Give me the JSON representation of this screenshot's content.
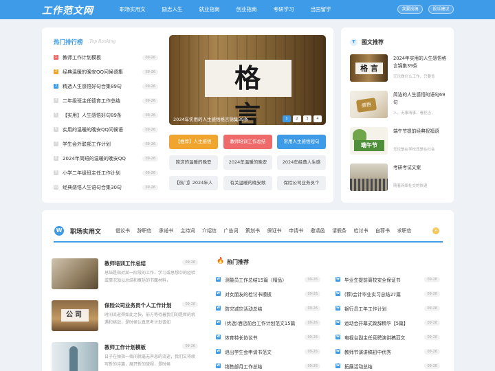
{
  "header": {
    "logo": "工作范文网",
    "nav": [
      "职场实用文",
      "励志人生",
      "就业指南",
      "创业指南",
      "考研学习",
      "出国留学"
    ],
    "login": "我要投稿",
    "register": "投诉建议"
  },
  "ranking": {
    "title": "热门排行榜",
    "subtitle": "Top Ranking",
    "items": [
      {
        "num": "1",
        "text": "教师工作计划模板",
        "date": "09-26"
      },
      {
        "num": "2",
        "text": "经典温暖的晚安QQ问候语集",
        "date": "09-26"
      },
      {
        "num": "3",
        "text": "精选人生感悟好句合集89句",
        "date": "09-26"
      },
      {
        "num": "4",
        "text": "二年级班主任德育工作总结",
        "date": "09-26"
      },
      {
        "num": "5",
        "text": "【实用】人生感悟好句89条",
        "date": "09-26"
      },
      {
        "num": "6",
        "text": "实用的温暖的晚安QQ问候语",
        "date": "09-26"
      },
      {
        "num": "7",
        "text": "学生会外联部工作计划",
        "date": "09-26"
      },
      {
        "num": "8",
        "text": "2024年简短的温暖的晚安QQ",
        "date": "09-26"
      },
      {
        "num": "9",
        "text": "小学二年级班主任工作计划",
        "date": "09-26"
      },
      {
        "num": "10",
        "text": "经典感悟人生语句合集30句",
        "date": "09-26"
      }
    ]
  },
  "banner": {
    "big_text": "格言",
    "caption": "2024年实用的人生感悟格言锦集39条",
    "pages": [
      "1",
      "2",
      "3",
      "4"
    ]
  },
  "tags": [
    {
      "text": "【推荐】人生感悟",
      "bg": "#f0a62e",
      "color": "#fff"
    },
    {
      "text": "教师培训工作总结",
      "bg": "#ef6b6b",
      "color": "#fff"
    },
    {
      "text": "常用人生感悟短句",
      "bg": "#3e9be8",
      "color": "#fff"
    },
    {
      "text": "简洁的温暖的晚安",
      "bg": "#eef0f3",
      "color": "#444"
    },
    {
      "text": "2024年温暖的晚安",
      "bg": "#eef0f3",
      "color": "#444"
    },
    {
      "text": "2024年经典人生感",
      "bg": "#eef0f3",
      "color": "#444"
    },
    {
      "text": "【热门】2024年人",
      "bg": "#eef0f3",
      "color": "#444"
    },
    {
      "text": "有关温暖的晚安歌",
      "bg": "#eef0f3",
      "color": "#444"
    },
    {
      "text": "保险公司业务员个",
      "bg": "#eef0f3",
      "color": "#444"
    }
  ],
  "picks": {
    "icon": "T",
    "title": "图文推荐",
    "items": [
      {
        "name": "2024年实用的人生感悟格言锦集39条",
        "desc": "无论做什么工作，只要肯",
        "img_text": "格 言"
      },
      {
        "name": "简洁的人生感悟的语句69句",
        "desc": "人，无事清事，看犯当，",
        "img_text": "感悟"
      },
      {
        "name": "端午节提前经典祝福语",
        "desc": "无论是在学校还是在社会",
        "img_text": "端午节"
      },
      {
        "name": "考研考试文案",
        "desc": "随着网络社交的快速",
        "img_text": ""
      }
    ]
  },
  "section": {
    "icon": "W",
    "title": "职场实用文",
    "cats": [
      "倡议书",
      "辞职信",
      "承诺书",
      "主持词",
      "介绍信",
      "广告词",
      "策划书",
      "保证书",
      "申请书",
      "邀请函",
      "请假条",
      "检讨书",
      "自荐书",
      "求职信"
    ],
    "more": "»"
  },
  "articles": [
    {
      "title": "教师培训工作总结",
      "date": "09-26",
      "desc": "总结是指对某一阶段的工作、学习或思想中的经验或情况加以总结和概括的书面材料，"
    },
    {
      "title": "保险公司业务员个人工作计划",
      "date": "09-26",
      "desc": "时间流逝得如此之快，前方等待着我们的是新的机遇和挑战，是时候认真思考计划该如"
    },
    {
      "title": "教师工作计划模板",
      "date": "09-26",
      "desc": "日子在弹指一挥间就毫无声息的流逝，我们又将续写新的诗篇，展开新的旅程，是时候"
    }
  ],
  "hot": {
    "title": "热门推荐",
    "left": [
      {
        "text": "测量员工作总结15篇（精品）",
        "date": "09-26"
      },
      {
        "text": "对女朋友的检讨书模板",
        "date": "09-26"
      },
      {
        "text": "防灾减灾活动总结",
        "date": "09-26"
      },
      {
        "text": "(优选)酒店前台工作计划范文15篇",
        "date": "09-26"
      },
      {
        "text": "体育特长协议书",
        "date": "09-26"
      },
      {
        "text": "退出学生会申请书范文",
        "date": "09-26"
      },
      {
        "text": "销售部月工作总结",
        "date": "09-26"
      }
    ],
    "right": [
      {
        "text": "毕业生提前离校安全保证书",
        "date": "09-26"
      },
      {
        "text": "(荐)会计毕业实习总结27篇",
        "date": "09-26"
      },
      {
        "text": "银行员工年工作计划",
        "date": "09-26"
      },
      {
        "text": "运动会开幕式致辞精华【5篇】",
        "date": "09-26"
      },
      {
        "text": "电视台副主任竞聘演讲稿范文",
        "date": "09-26"
      },
      {
        "text": "教师节演讲稿初中优秀",
        "date": "09-26"
      },
      {
        "text": "拓展活动总结",
        "date": "09-26"
      }
    ]
  },
  "colors": {
    "accent": "#3e9be8",
    "orange": "#f0a62e",
    "red": "#ef6b6b"
  }
}
